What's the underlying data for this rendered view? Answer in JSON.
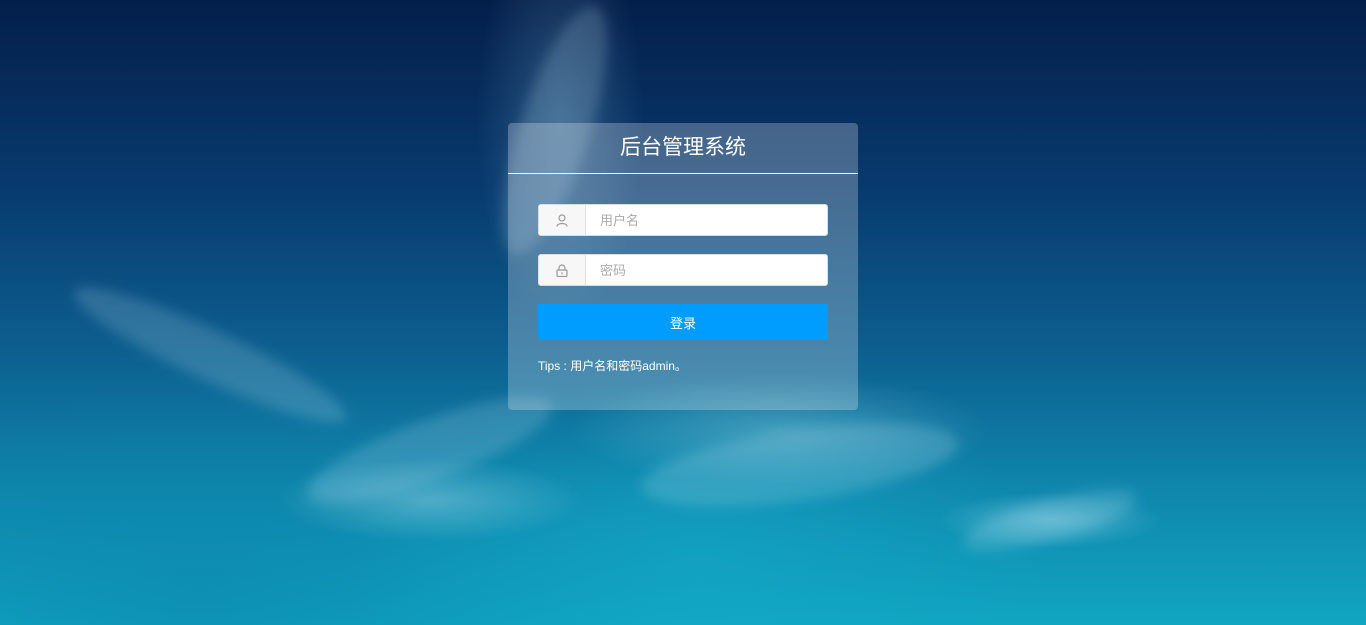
{
  "login": {
    "title": "后台管理系统",
    "username": {
      "icon": "user-icon",
      "placeholder": "用户名",
      "value": ""
    },
    "password": {
      "icon": "lock-icon",
      "placeholder": "密码",
      "value": ""
    },
    "submit_label": "登录",
    "tips": "Tips : 用户名和密码admin。"
  },
  "colors": {
    "button": "#009dff",
    "panel": "rgba(255,255,255,0.25)",
    "text": "#ffffff"
  }
}
